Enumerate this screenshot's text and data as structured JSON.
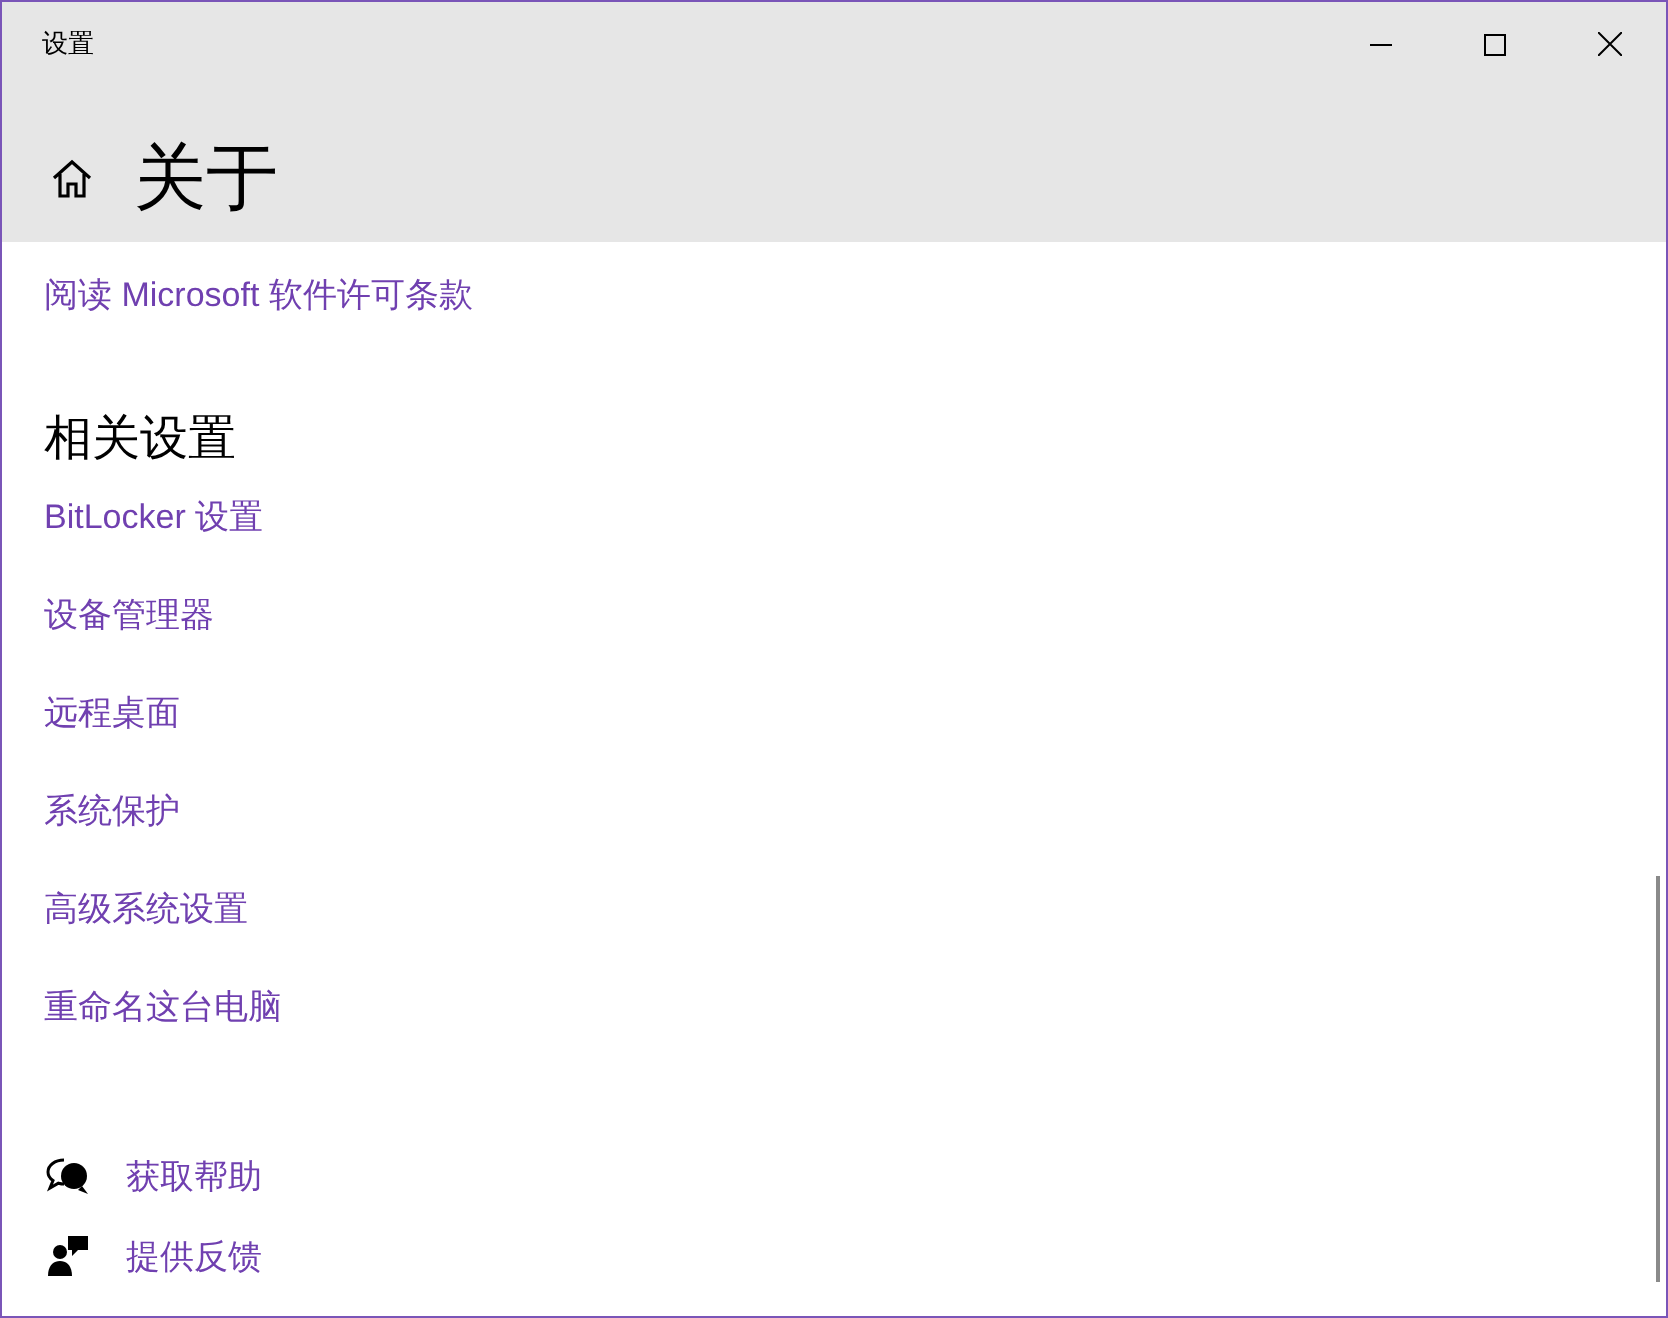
{
  "window": {
    "title": "设置"
  },
  "page": {
    "title": "关于"
  },
  "top_link": "阅读 Microsoft 软件许可条款",
  "related": {
    "heading": "相关设置",
    "links": [
      "BitLocker 设置",
      "设备管理器",
      "远程桌面",
      "系统保护",
      "高级系统设置",
      "重命名这台电脑"
    ]
  },
  "footer": [
    {
      "kind": "help",
      "label": "获取帮助"
    },
    {
      "kind": "feedback",
      "label": "提供反馈"
    }
  ]
}
